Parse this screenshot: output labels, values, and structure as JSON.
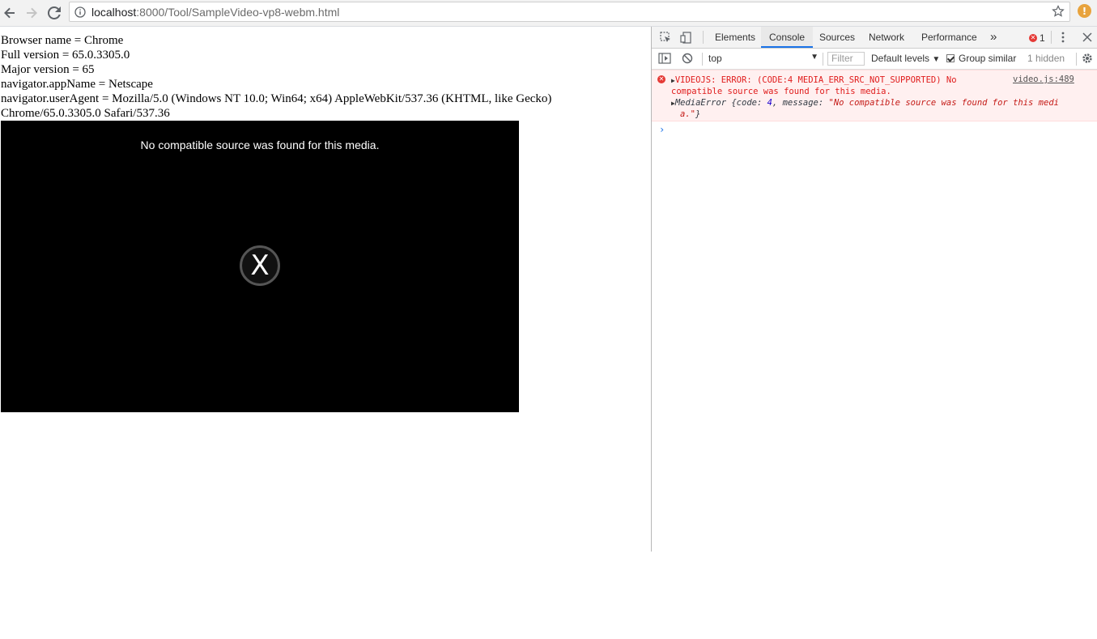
{
  "browser": {
    "url_host": "localhost",
    "url_path": ":8000/Tool/SampleVideo-vp8-webm.html",
    "ext_badge": "!"
  },
  "page": {
    "lines": [
      "Browser name = Chrome",
      "Full version = 65.0.3305.0",
      "Major version = 65",
      "navigator.appName = Netscape",
      "navigator.userAgent = Mozilla/5.0 (Windows NT 10.0; Win64; x64) AppleWebKit/537.36 (KHTML, like Gecko)",
      "Chrome/65.0.3305.0 Safari/537.36"
    ],
    "video": {
      "message": "No compatible source was found for this media.",
      "error_glyph": "X"
    }
  },
  "devtools": {
    "tabs": [
      "Elements",
      "Console",
      "Sources",
      "Network",
      "Performance"
    ],
    "more_tabs": "»",
    "error_count": "1",
    "context": "top",
    "filter_placeholder": "Filter",
    "levels": "Default levels",
    "group_similar": "Group similar",
    "hidden": "1 hidden",
    "error": {
      "line1": "VIDEOJS: ERROR: (CODE:4 MEDIA_ERR_SRC_NOT_SUPPORTED) No",
      "line2": "compatible source was found for this media.",
      "source": "video.js:489",
      "obj_prefix": "MediaError {code: ",
      "obj_code": "4",
      "obj_mid": ", message: ",
      "obj_msg1": "\"No compatible source was found for this medi",
      "obj_msg2": "a.\"",
      "obj_suffix": "}"
    },
    "prompt": "›"
  }
}
